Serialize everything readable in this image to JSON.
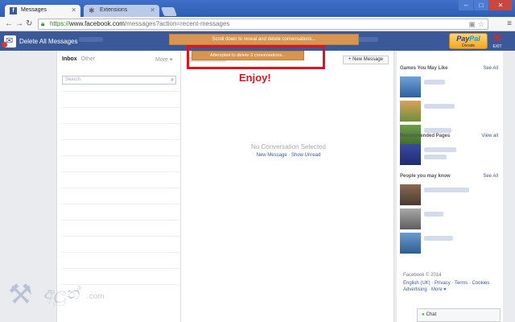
{
  "browser": {
    "tabs": [
      {
        "label": "Messages",
        "active": true
      },
      {
        "label": "Extensions",
        "active": false
      }
    ],
    "url": {
      "scheme": "https://",
      "host": "www.facebook.com",
      "path": "/messages?action=recent-messages"
    }
  },
  "extension": {
    "title": "Delete All Messages",
    "notice_scroll": "Scroll down to reveal and delete conversations...",
    "notice_attempt": "Attempted to delete 3 conversations...",
    "enjoy": "Enjoy!",
    "paypal_logo_pay": "Pay",
    "paypal_logo_pal": "Pal",
    "paypal_donate": "Donate",
    "exit": "EXIT"
  },
  "messages": {
    "tab_inbox": "Inbox",
    "tab_other": "Other",
    "more": "More ▾",
    "search_placeholder": "Search",
    "new_message": "+ New Message",
    "no_conversation": "No Conversation Selected",
    "link_new_message": "New Message",
    "link_separator": " · ",
    "link_show_unread": "Show Unread"
  },
  "sidebar": {
    "games_title": "Games You May Like",
    "games_link": "See All",
    "pages_title": "Recommended Pages",
    "pages_link": "View all",
    "people_title": "People you may know",
    "people_link": "See All",
    "footer_copyright": "Facebook © 2014",
    "footer_links": [
      "English (UK)",
      "Privacy",
      "Terms",
      "Cookies",
      "Advertising",
      "More ▾"
    ]
  },
  "chat": {
    "label": "Chat"
  },
  "watermark": {
    "com": ".com"
  }
}
